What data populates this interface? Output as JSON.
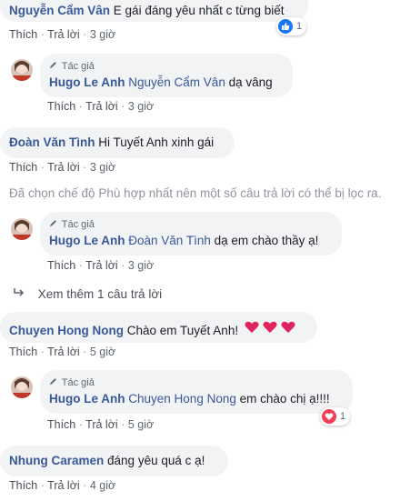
{
  "actions": {
    "like": "Thích",
    "reply": "Trả lời"
  },
  "author_label": "Tác giả",
  "comments": [
    {
      "name": "Nguyễn Cẩm Vân",
      "text": "E gái đáng yêu nhất c từng biết",
      "time": "3 giờ",
      "reaction_count": "1",
      "reaction_icon": "like-icon"
    },
    {
      "reply_name": "Hugo Le Anh",
      "tag": "Nguyễn Cẩm Vân",
      "text": "dạ vâng",
      "time": "3 giờ"
    },
    {
      "name": "Đoàn Văn Tình",
      "text": "Hi Tuyết Anh xinh gái",
      "time": "3 giờ"
    },
    {
      "reply_name": "Hugo Le Anh",
      "tag": "Đoàn Văn Tình",
      "text": "dạ em chào thầy ạ!",
      "time": "3 giờ"
    },
    {
      "name": "Chuyen Hong Nong",
      "text": "Chào em Tuyết Anh!",
      "time": "5 giờ"
    },
    {
      "reply_name": "Hugo Le Anh",
      "tag": "Chuyen Hong Nong",
      "text": "em chào chị ạ!!!!",
      "time": "5 giờ",
      "reaction_count": "1",
      "reaction_icon": "heart-icon"
    },
    {
      "name": "Nhung Caramen",
      "text": "đáng yêu quá c ạ!",
      "time": "4 giờ"
    }
  ],
  "filter_notice": "Đã chọn chế độ Phù hợp nhất nên một số câu trả lời có thể bị lọc ra.",
  "see_more": "Xem thêm 1 câu trả lời",
  "colors": {
    "name": "#385898",
    "bubble": "#f2f3f5",
    "like": "#1877f2",
    "heart": "#f33e58"
  }
}
